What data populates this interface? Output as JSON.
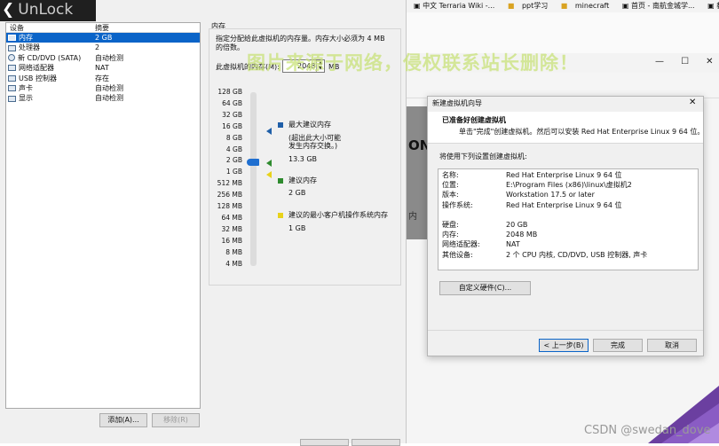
{
  "overlay": {
    "unlock_text": "UnLock",
    "arrow": "❮"
  },
  "devices": {
    "headers": {
      "device": "设备",
      "summary": "摘要"
    },
    "rows": [
      {
        "name": "内存",
        "summary": "2 GB",
        "icon": "memory-icon"
      },
      {
        "name": "处理器",
        "summary": "2",
        "icon": "cpu-icon"
      },
      {
        "name": "新 CD/DVD (SATA)",
        "summary": "自动检测",
        "icon": "disc-icon"
      },
      {
        "name": "网络适配器",
        "summary": "NAT",
        "icon": "network-icon"
      },
      {
        "name": "USB 控制器",
        "summary": "存在",
        "icon": "usb-icon"
      },
      {
        "name": "声卡",
        "summary": "自动检测",
        "icon": "sound-icon"
      },
      {
        "name": "显示",
        "summary": "自动检测",
        "icon": "display-icon"
      }
    ],
    "add_button": "添加(A)...",
    "remove_button": "移除(R)"
  },
  "memory": {
    "group_title": "内存",
    "desc_line1": "指定分配给此虚拟机的内存量。内存大小必须为 4 MB",
    "desc_line2": "的倍数。",
    "field_label": "此虚拟机的内存(M):",
    "field_value": "2048",
    "field_unit": "MB",
    "ticks": [
      "128 GB",
      "64 GB",
      "32 GB",
      "16 GB",
      "8 GB",
      "4 GB",
      "2 GB",
      "1 GB",
      "512 MB",
      "256 MB",
      "128 MB",
      "64 MB",
      "32 MB",
      "16 MB",
      "8 MB",
      "4 MB"
    ],
    "legend": {
      "max_label": "最大建议内存",
      "max_note1": "(超出此大小可能",
      "max_note2": "发生内存交换。)",
      "max_value": "13.3 GB",
      "rec_label": "建议内存",
      "rec_value": "2 GB",
      "min_label": "建议的最小客户机操作系统内存",
      "min_value": "1 GB"
    },
    "colors": {
      "max": "#1f5fa8",
      "rec": "#2e8b2e",
      "min": "#e8d21a",
      "slider": "#1f6fd0"
    }
  },
  "browser": {
    "bookmarks": [
      "中文 Terraria Wiki -...",
      "ppt学习",
      "minecraft",
      "首页 - 南航金城学...",
      "教学"
    ],
    "partial_text": "ON",
    "partial_text2": "内"
  },
  "wizard": {
    "title": "新建虚拟机向导",
    "heading": "已准备好创建虚拟机",
    "subheading": "单击\"完成\"创建虚拟机。然后可以安装 Red Hat Enterprise Linux 9 64 位。",
    "intro": "将使用下列设置创建虚拟机:",
    "settings": [
      {
        "k": "名称:",
        "v": "Red Hat Enterprise Linux 9 64 位"
      },
      {
        "k": "位置:",
        "v": "E:\\Program Files (x86)\\linux\\虚拟机2"
      },
      {
        "k": "版本:",
        "v": "Workstation 17.5 or later"
      },
      {
        "k": "操作系统:",
        "v": "Red Hat Enterprise Linux 9 64 位"
      },
      {
        "k": "",
        "v": ""
      },
      {
        "k": "硬盘:",
        "v": "20 GB"
      },
      {
        "k": "内存:",
        "v": "2048 MB"
      },
      {
        "k": "网络适配器:",
        "v": "NAT"
      },
      {
        "k": "其他设备:",
        "v": "2 个 CPU 内核, CD/DVD, USB 控制器, 声卡"
      }
    ],
    "customize_button": "自定义硬件(C)...",
    "back_button": "< 上一步(B)",
    "finish_button": "完成",
    "cancel_button": "取消"
  },
  "watermark": "图片来源于网络，侵权联系站长删除！",
  "csdn_credit": "CSDN @swedan_dove"
}
